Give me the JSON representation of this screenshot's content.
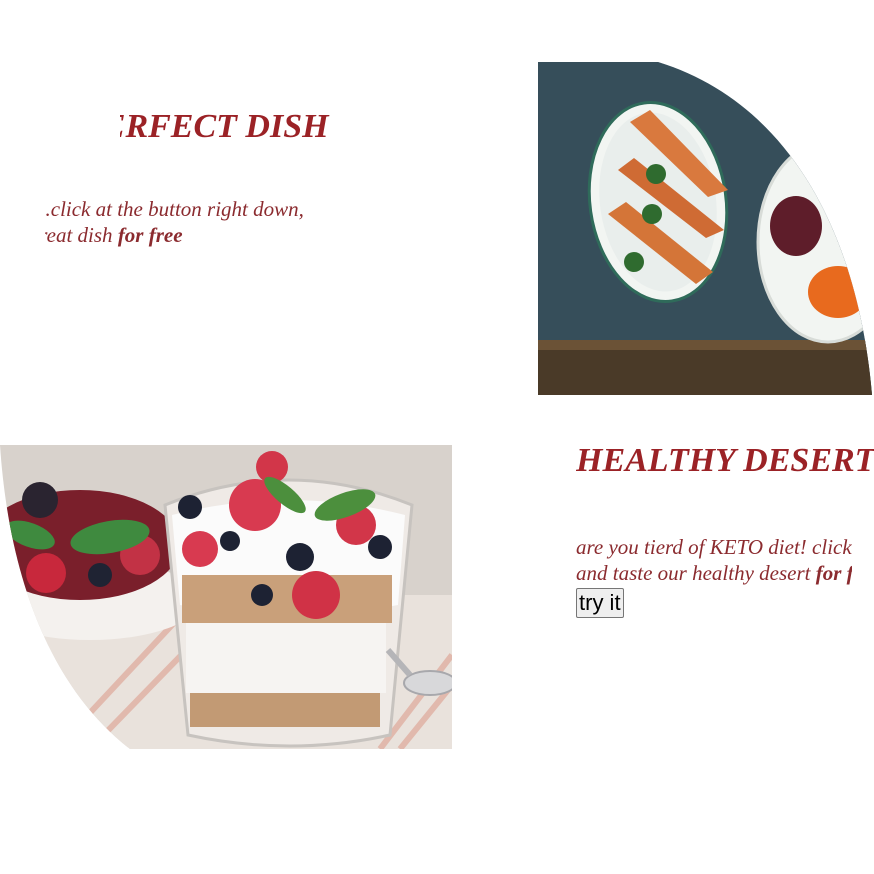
{
  "section1": {
    "title": "PERFECT DISH",
    "line1": "...click at the button right down,",
    "line2_prefix": "...great dish ",
    "line2_bold": "for free"
  },
  "section2": {
    "title": "HEALTHY DESERT",
    "line1": "are you tierd of KETO diet! click",
    "line2_prefix": "and taste our healthy desert ",
    "line2_bold": "for free",
    "button_label": "try it"
  }
}
